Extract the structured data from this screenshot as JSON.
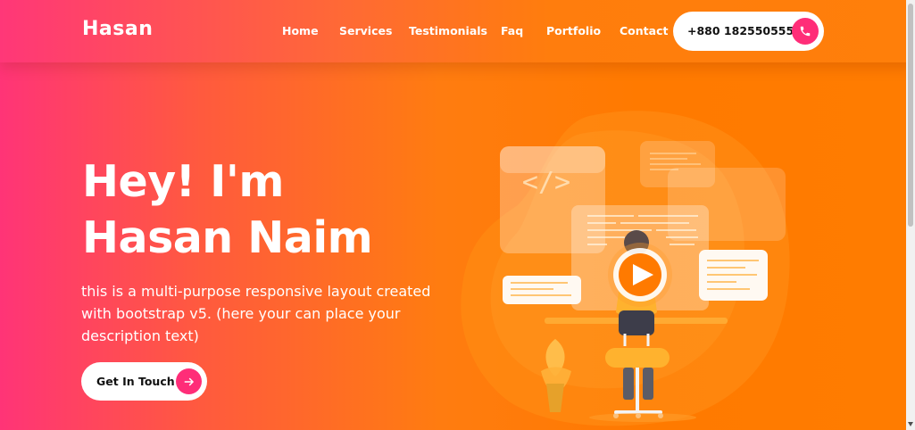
{
  "navbar": {
    "brand": "Hasan",
    "links": [
      {
        "label": "Home"
      },
      {
        "label": "Services"
      },
      {
        "label": "Testimonials"
      },
      {
        "label": "Faq"
      },
      {
        "label": "Portfolio"
      },
      {
        "label": "Contact"
      }
    ],
    "phone": "+880 1825505556",
    "phone_icon": "phone-icon"
  },
  "hero": {
    "title_line1": "Hey! I'm",
    "title_line2": "Hasan Naim",
    "description": "this is a multi-purpose responsive layout created with bootstrap v5. (here your can place your description text)",
    "cta_label": "Get In Touch",
    "cta_icon": "arrow-right-icon"
  },
  "illustration": {
    "code_symbol": "</>",
    "play_icon": "play-icon"
  },
  "colors": {
    "gradient_start": "#ff3477",
    "gradient_end": "#ff7c00",
    "accent": "#ff2d78"
  }
}
